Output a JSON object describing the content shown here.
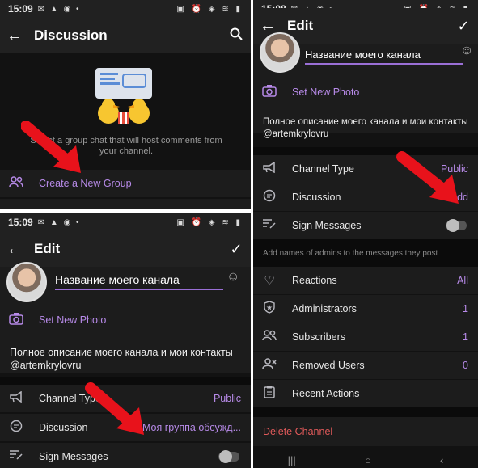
{
  "panel_a": {
    "status_time": "15:09",
    "title": "Discussion",
    "description": "Select a group chat that will host comments from your channel.",
    "create_group_label": "Create a New Group"
  },
  "panel_b": {
    "status_time": "15:09",
    "title": "Edit",
    "channel_name": "Название моего канала",
    "set_photo_label": "Set New Photo",
    "description": "Полное описание моего канала и мои контакты @artemkrylovru",
    "channel_type_label": "Channel Type",
    "channel_type_value": "Public",
    "discussion_label": "Discussion",
    "discussion_value": "Моя группа обсужд...",
    "sign_messages_label": "Sign Messages"
  },
  "panel_c": {
    "status_time": "15:08",
    "title": "Edit",
    "channel_name": "Название моего канала",
    "set_photo_label": "Set New Photo",
    "description": "Полное описание моего канала и мои контакты @artemkrylovru",
    "channel_type_label": "Channel Type",
    "channel_type_value": "Public",
    "discussion_label": "Discussion",
    "discussion_value": "Add",
    "sign_messages_label": "Sign Messages",
    "sign_hint": "Add names of admins to the messages they post",
    "reactions_label": "Reactions",
    "reactions_value": "All",
    "administrators_label": "Administrators",
    "administrators_value": "1",
    "subscribers_label": "Subscribers",
    "subscribers_value": "1",
    "removed_users_label": "Removed Users",
    "removed_users_value": "0",
    "recent_actions_label": "Recent Actions",
    "delete_channel_label": "Delete Channel"
  },
  "colors": {
    "accent": "#b78ae8",
    "destructive": "#e05a5a",
    "arrow": "#e8121b",
    "background": "#121212"
  }
}
